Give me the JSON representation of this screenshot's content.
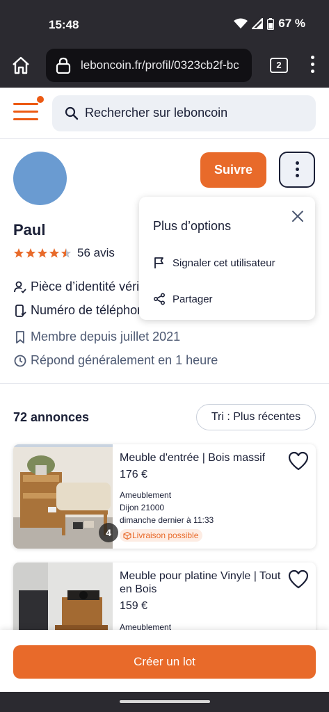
{
  "status_bar": {
    "time": "15:48",
    "battery": "67 %"
  },
  "browser": {
    "url": "leboncoin.fr/profil/0323cb2f-bc",
    "tab_count": "2"
  },
  "search": {
    "placeholder": "Rechercher sur leboncoin"
  },
  "profile": {
    "name": "Paul",
    "rating": 4.5,
    "reviews": "56 avis",
    "follow_label": "Suivre",
    "badges": [
      "Pièce d’identité vérifiée",
      "Numéro de téléphone vérifié"
    ],
    "member_since": "Membre depuis juillet 2021",
    "response_time": "Répond généralement en 1 heure"
  },
  "dropdown": {
    "title": "Plus d’options",
    "items": [
      "Signaler cet utilisateur",
      "Partager"
    ]
  },
  "listings": {
    "count": "72 annonces",
    "sort_label": "Tri : Plus récentes",
    "items": [
      {
        "title": "Meuble d'entrée | Bois massif",
        "price": "176 €",
        "category": "Ameublement",
        "location": "Dijon 21000",
        "date": "dimanche dernier à 11:33",
        "delivery": "Livraison possible",
        "photo_count": "4"
      },
      {
        "title": "Meuble pour platine Vinyle | Tout en Bois",
        "price": "159 €",
        "category": "Ameublement"
      }
    ]
  },
  "bottom": {
    "lot_label": "Créer un lot"
  },
  "colors": {
    "accent": "#e86a2a",
    "text": "#1a1f36",
    "muted": "#4e5a73"
  }
}
